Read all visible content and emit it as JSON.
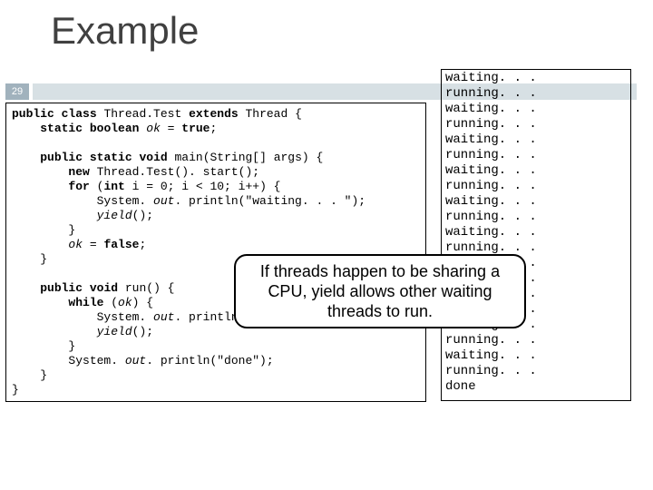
{
  "title": "Example",
  "page_number": "29",
  "code": "public class Thread.Test extends Thread {\n    static boolean ok = true;\n\n    public static void main(String[] args) {\n        new Thread.Test(). start();\n        for (int i = 0; i < 10; i++) {\n            System. out. println(\"waiting. . . \");\n            yield();\n        }\n        ok = false;\n    }\n\n    public void run() {\n        while (ok) {\n            System. out. println(\"running. . . \");\n            yield();\n        }\n        System. out. println(\"done\");\n    }\n}",
  "output": "waiting. . .\nrunning. . .\nwaiting. . .\nrunning. . .\nwaiting. . .\nrunning. . .\nwaiting. . .\nrunning. . .\nwaiting. . .\nrunning. . .\nwaiting. . .\nrunning. . .\nwaiting. . .\nrunning. . .\nwaiting. . .\nrunning. . .\nwaiting. . .\nrunning. . .\nwaiting. . .\nrunning. . .\ndone",
  "callout": "If threads happen to be sharing a CPU, yield allows other waiting threads to run.",
  "code_bold_tokens": [
    "public",
    "class",
    "extends",
    "static",
    "boolean",
    "true",
    "void",
    "new",
    "for",
    "int",
    "false",
    "while"
  ],
  "code_italic_tokens": [
    "ok",
    "out",
    "yield"
  ]
}
